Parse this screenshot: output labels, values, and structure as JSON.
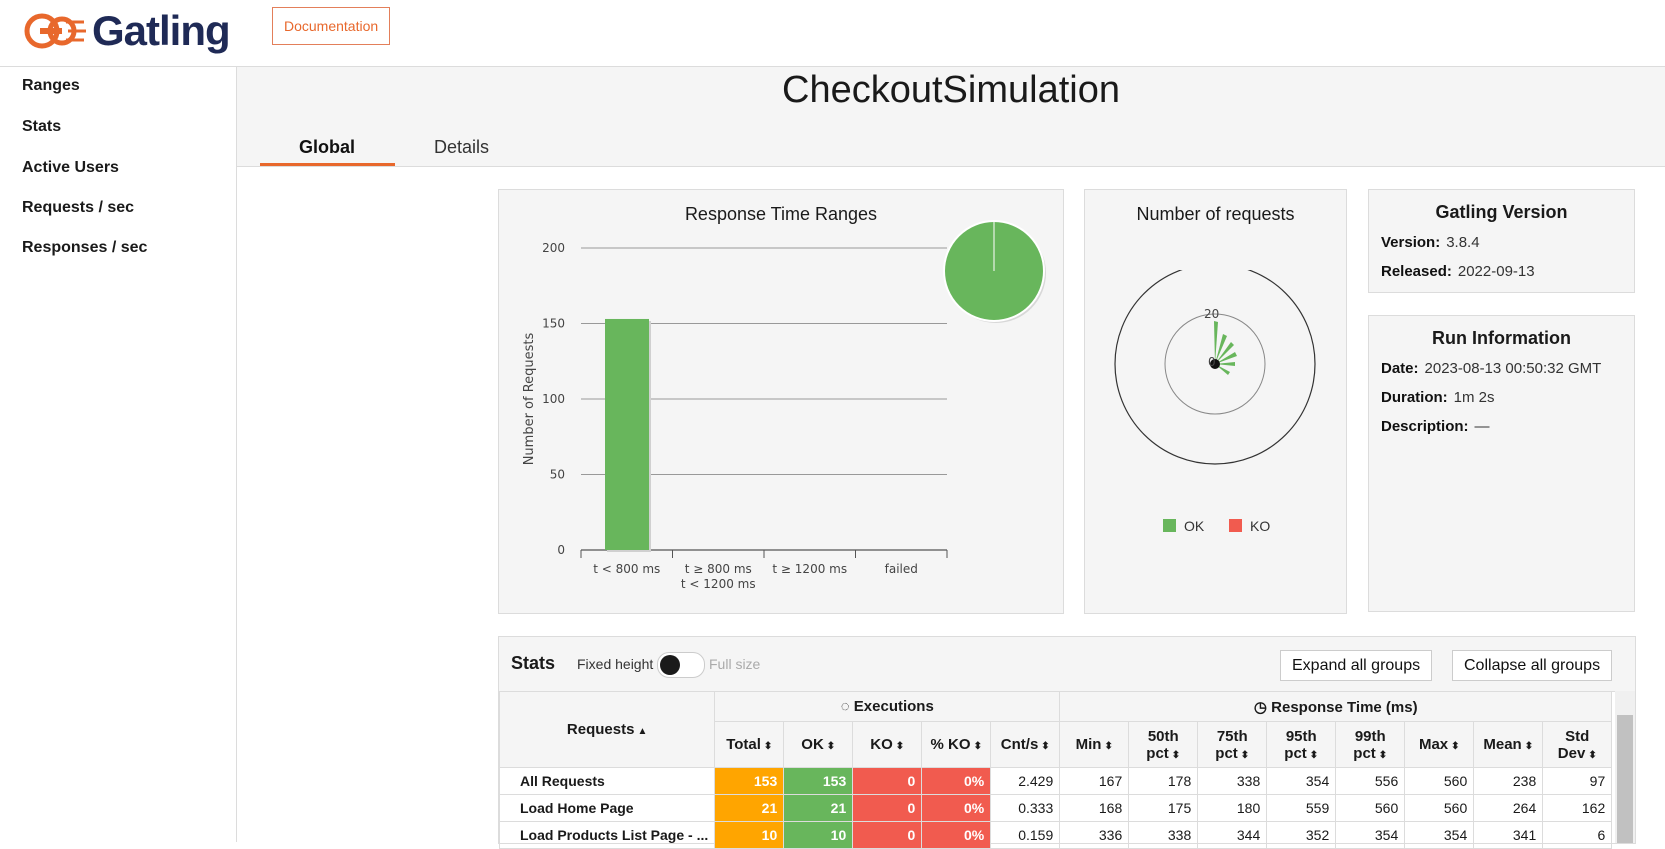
{
  "header": {
    "brand": "Gatling",
    "doc_button": "Documentation"
  },
  "sidebar": {
    "items": [
      {
        "label": "Ranges"
      },
      {
        "label": "Stats"
      },
      {
        "label": "Active Users"
      },
      {
        "label": "Requests / sec"
      },
      {
        "label": "Responses / sec"
      }
    ]
  },
  "page": {
    "title": "CheckoutSimulation",
    "tabs": [
      {
        "label": "Global"
      },
      {
        "label": "Details"
      }
    ]
  },
  "colors": {
    "ok": "#68b65c",
    "ko": "#f15b4f",
    "accent": "#e8682c",
    "total": "#ffa500"
  },
  "chart_data": [
    {
      "type": "bar",
      "title": "Response Time Ranges",
      "ylabel": "Number of Requests",
      "categories": [
        "t < 800 ms",
        "t ≥ 800 ms|t < 1200 ms",
        "t ≥ 1200 ms",
        "failed"
      ],
      "values": [
        153,
        0,
        0,
        0
      ],
      "ylim": [
        0,
        200
      ],
      "yticks": [
        0,
        50,
        100,
        150,
        200
      ],
      "grid": true
    },
    {
      "type": "pie",
      "title": "Number of requests",
      "radial_ticks": [
        "20",
        "0"
      ],
      "legend": [
        "OK",
        "KO"
      ],
      "legend_position": "bottom"
    }
  ],
  "version_card": {
    "title": "Gatling Version",
    "version_label": "Version:",
    "version": "3.8.4",
    "released_label": "Released:",
    "released": "2022-09-13"
  },
  "run_card": {
    "title": "Run Information",
    "date_label": "Date:",
    "date": "2023-08-13 00:50:32 GMT",
    "duration_label": "Duration:",
    "duration": "1m 2s",
    "description_label": "Description:",
    "description": "—"
  },
  "stats": {
    "title": "Stats",
    "fixed_label": "Fixed height",
    "full_label": "Full size",
    "expand_label": "Expand all groups",
    "collapse_label": "Collapse all groups",
    "requests_header": "Requests",
    "executions_header": "Executions",
    "response_header": "Response Time (ms)",
    "columns": [
      "Total",
      "OK",
      "KO",
      "% KO",
      "Cnt/s",
      "Min",
      "50th pct",
      "75th pct",
      "95th pct",
      "99th pct",
      "Max",
      "Mean",
      "Std Dev"
    ],
    "rows": [
      {
        "name": "All Requests",
        "cells": [
          "153",
          "153",
          "0",
          "0%",
          "2.429",
          "167",
          "178",
          "338",
          "354",
          "556",
          "560",
          "238",
          "97"
        ]
      },
      {
        "name": "Load Home Page",
        "cells": [
          "21",
          "21",
          "0",
          "0%",
          "0.333",
          "168",
          "175",
          "180",
          "559",
          "560",
          "560",
          "264",
          "162"
        ]
      },
      {
        "name": "Load Products List Page - ...",
        "cells": [
          "10",
          "10",
          "0",
          "0%",
          "0.159",
          "336",
          "338",
          "344",
          "352",
          "354",
          "354",
          "341",
          "6"
        ]
      }
    ]
  }
}
